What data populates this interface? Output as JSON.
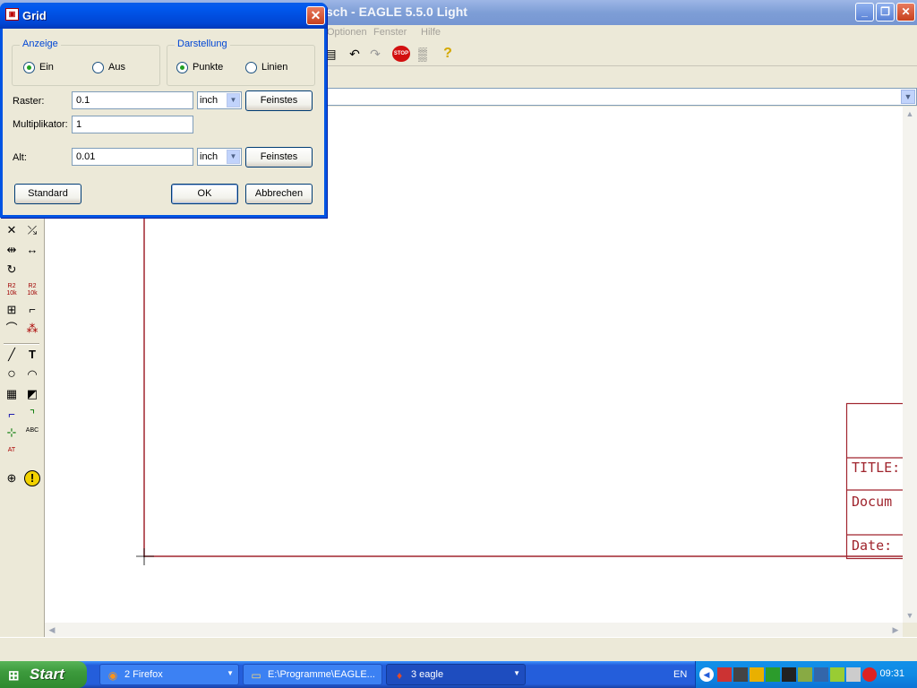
{
  "window": {
    "title": "sch - EAGLE 5.5.0 Light",
    "min_glyph": "_",
    "restore_glyph": "❐",
    "close_glyph": "✕"
  },
  "menu": {
    "items": [
      "Optionen",
      "Fenster",
      "Hilfe"
    ]
  },
  "toolbar": {
    "icons": [
      {
        "name": "script-icon",
        "glyph": "▤"
      },
      {
        "name": "undo-icon",
        "glyph": "↶"
      },
      {
        "name": "redo-icon",
        "glyph": "↷"
      },
      {
        "name": "stop-icon",
        "glyph": "STOP"
      },
      {
        "name": "go-icon",
        "glyph": "▒"
      },
      {
        "name": "help-icon",
        "glyph": "?"
      }
    ]
  },
  "palette": {
    "icons": [
      {
        "name": "delete-icon",
        "glyph": "✕"
      },
      {
        "name": "add-icon",
        "glyph": "⤰"
      },
      {
        "name": "mirror-icon",
        "glyph": "⇹"
      },
      {
        "name": "move-icon",
        "glyph": "↔"
      },
      {
        "name": "rotate-icon",
        "glyph": "↻"
      },
      {
        "name": "name-icon",
        "glyph": "R2\n10k"
      },
      {
        "name": "value-icon",
        "glyph": "R2\n10k"
      },
      {
        "name": "smash-icon",
        "glyph": "⊞"
      },
      {
        "name": "miter-icon",
        "glyph": "⌐"
      },
      {
        "name": "split-icon",
        "glyph": "⌒"
      },
      {
        "name": "invoke-icon",
        "glyph": "⁂"
      },
      {
        "name": "wire-icon",
        "glyph": "╱"
      },
      {
        "name": "text-icon",
        "glyph": "T"
      },
      {
        "name": "circle-icon",
        "glyph": "○"
      },
      {
        "name": "arc-icon",
        "glyph": "◠"
      },
      {
        "name": "rect-icon",
        "glyph": "▦"
      },
      {
        "name": "polygon-icon",
        "glyph": "◩"
      },
      {
        "name": "bus-icon",
        "glyph": "⌐"
      },
      {
        "name": "net-icon",
        "glyph": "⌝"
      },
      {
        "name": "junction-icon",
        "glyph": "⊹"
      },
      {
        "name": "label-icon",
        "glyph": "ABC"
      },
      {
        "name": "attribute-icon",
        "glyph": "AT"
      },
      {
        "name": "erc-icon",
        "glyph": "⊕"
      },
      {
        "name": "errors-icon",
        "glyph": "!"
      }
    ]
  },
  "frame": {
    "title_label": "TITLE:",
    "document_label": "Docum",
    "date_label": "Date:"
  },
  "dialog": {
    "title": "Grid",
    "icon_glyph": "▣",
    "close_glyph": "✕",
    "anzeige": {
      "legend": "Anzeige",
      "on_label": "Ein",
      "off_label": "Aus",
      "selected": "Ein"
    },
    "darstellung": {
      "legend": "Darstellung",
      "dots_label": "Punkte",
      "lines_label": "Linien",
      "selected": "Punkte"
    },
    "raster": {
      "label": "Raster:",
      "value": "0.1",
      "unit": "inch",
      "finest_label": "Feinstes"
    },
    "multiplikator": {
      "label": "Multiplikator:",
      "value": "1"
    },
    "alt": {
      "label": "Alt:",
      "value": "0.01",
      "unit": "inch",
      "finest_label": "Feinstes"
    },
    "standard_label": "Standard",
    "ok_label": "OK",
    "cancel_label": "Abbrechen",
    "dropdown_glyph": "▼"
  },
  "taskbar": {
    "start_label": "Start",
    "start_glyph": "⊞",
    "tasks": [
      {
        "icon": "firefox-icon",
        "glyph": "◉",
        "label": "2 Firefox",
        "active": false
      },
      {
        "icon": "folder-icon",
        "glyph": "▭",
        "label": "E:\\Programme\\EAGLE...",
        "active": false
      },
      {
        "icon": "eagle-icon",
        "glyph": "♦",
        "label": "3 eagle",
        "active": true
      }
    ],
    "task_arrow": "▼",
    "lang": "EN",
    "clock": "09:31"
  },
  "scroll": {
    "up": "▲",
    "down": "▼",
    "left": "◀",
    "right": "▶"
  },
  "colors": {
    "frame_line": "#a0252e",
    "xp_blue": "#0054e3"
  }
}
